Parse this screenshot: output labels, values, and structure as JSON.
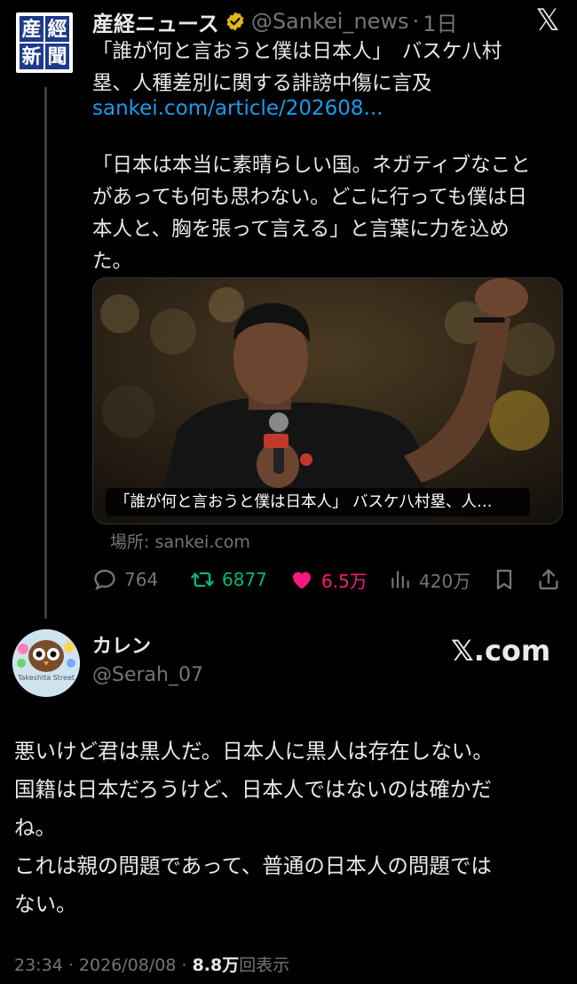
{
  "tweet": {
    "avatar_chars": [
      "産",
      "經",
      "新",
      "聞"
    ],
    "display_name": "産経ニュース",
    "handle": "@Sankei_news",
    "separator": "·",
    "time": "1日",
    "close_glyph": "𝕏",
    "headline_line1": "「誰が何と言おうと僕は日本人」　バスケ八村",
    "headline_line2": "塁、人種差別に関する誹謗中傷に言及",
    "link": "sankei.com/article/202608...",
    "quote_lines": [
      "「日本は本当に素晴らしい国。ネガティブなこと",
      "があっても何も思わない。どこに行っても僕は日",
      "本人と、胸を張って言える」と言葉に力を込め",
      "た。"
    ],
    "media_caption": "「誰が何と言おうと僕は日本人」 バスケ八村塁、人…",
    "source": "場所: sankei.com",
    "actions": {
      "replies": "764",
      "reposts": "6877",
      "likes": "6.5万",
      "views": "420万"
    }
  },
  "reply": {
    "avatar_text": "Takeshita Street",
    "display_name": "カレン",
    "handle": "@Serah_07",
    "brand": "𝕏.com",
    "text_lines": [
      "悪いけど君は黒人だ。日本人に黒人は存在しない。",
      "国籍は日本だろうけど、日本人ではないのは確かだ",
      "ね。",
      "これは親の問題であって、普通の日本人の問題では",
      "ない。"
    ],
    "time": "23:34",
    "date": "2026/08/08",
    "separator": "·",
    "view_count": "8.8万",
    "view_suffix": "回表示"
  },
  "colors": {
    "background": "#000000",
    "text": "#e7e9ea",
    "muted": "#71767b",
    "link": "#1d9bf0",
    "repost": "#00ba7c",
    "like": "#f91880",
    "verified": "#e2b719"
  }
}
